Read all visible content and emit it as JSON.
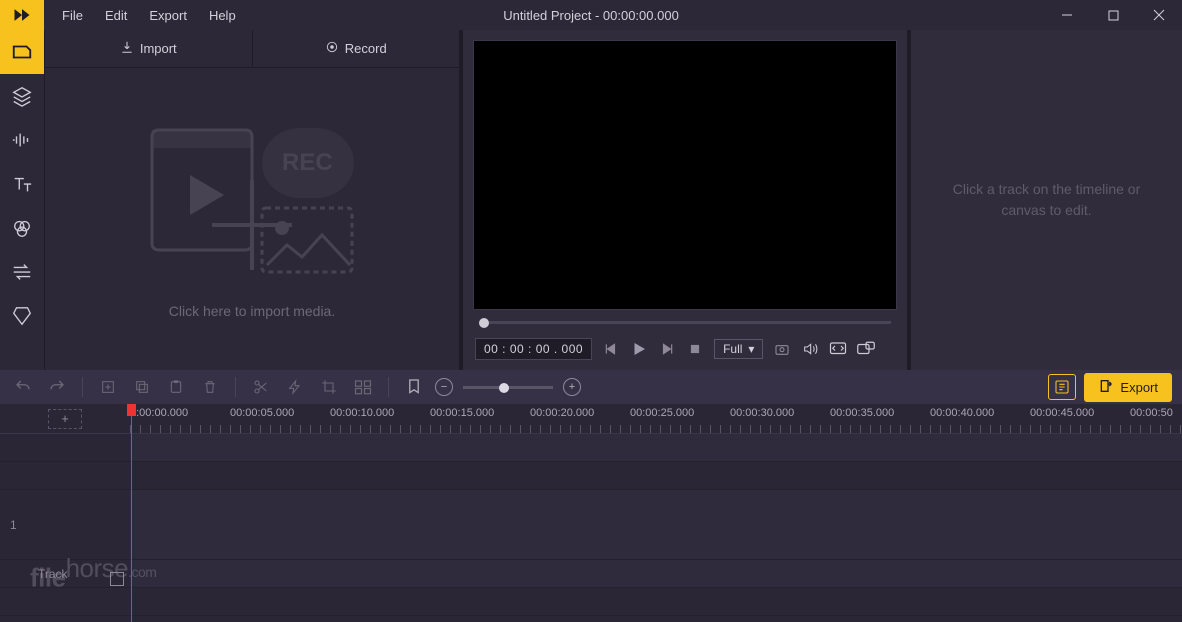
{
  "titlebar": {
    "title": "Untitled Project - 00:00:00.000",
    "menu": [
      "File",
      "Edit",
      "Export",
      "Help"
    ]
  },
  "sidebar": {
    "items": [
      {
        "name": "media-tab",
        "active": true
      },
      {
        "name": "layers-tab",
        "active": false
      },
      {
        "name": "audio-tab",
        "active": false
      },
      {
        "name": "text-tab",
        "active": false
      },
      {
        "name": "filters-tab",
        "active": false
      },
      {
        "name": "transitions-tab",
        "active": false
      },
      {
        "name": "elements-tab",
        "active": false
      }
    ]
  },
  "media_panel": {
    "import_label": "Import",
    "record_label": "Record",
    "hint": "Click here to import media.",
    "placeholder_badge": "REC"
  },
  "preview": {
    "timecode": "00 : 00 : 00 . 000",
    "view_mode": "Full"
  },
  "properties": {
    "hint": "Click a track on the timeline or canvas to edit."
  },
  "timeline_toolbar": {
    "export_label": "Export"
  },
  "timeline": {
    "ticks": [
      "0:00:00.000",
      "00:00:05.000",
      "00:00:10.000",
      "00:00:15.000",
      "00:00:20.000",
      "00:00:25.000",
      "00:00:30.000",
      "00:00:35.000",
      "00:00:40.000",
      "00:00:45.000",
      "00:00:50"
    ],
    "row_number": "1",
    "track_label": "Track"
  },
  "watermark": {
    "a": "file",
    "b": "horse",
    "c": ".com"
  }
}
